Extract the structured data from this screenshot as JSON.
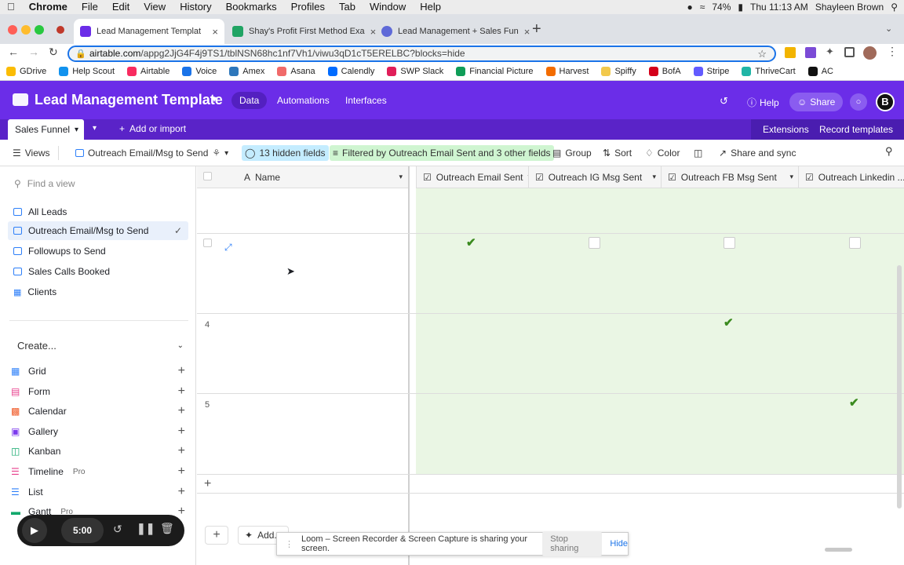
{
  "menubar": {
    "apple": "",
    "items": [
      "Chrome",
      "File",
      "Edit",
      "View",
      "History",
      "Bookmarks",
      "Profiles",
      "Tab",
      "Window",
      "Help"
    ],
    "battery": "74%",
    "clock": "Thu 11:13 AM",
    "user": "Shayleen Brown"
  },
  "tabs": [
    {
      "title": "Lead Management Templat",
      "favicon_color": "#6b2de8"
    },
    {
      "title": "Shay's Profit First Method Exa",
      "favicon_color": "#20a464"
    },
    {
      "title": "Lead Management + Sales Fun",
      "favicon_color": "#5f6ad8"
    }
  ],
  "url": {
    "host": "airtable.com",
    "path": "/appg2JjG4F4j9TS1/tblNSN68hc1nf7Vh1/viwu3qD1cT5ERELBC?blocks=hide"
  },
  "bookmarks": [
    {
      "label": "GDrive",
      "color": "#fbbc04"
    },
    {
      "label": "Help Scout",
      "color": "#1292ee"
    },
    {
      "label": "Airtable",
      "color": "#f82b60"
    },
    {
      "label": "Voice",
      "color": "#1a73e8"
    },
    {
      "label": "Amex",
      "color": "#2e77bb"
    },
    {
      "label": "Asana",
      "color": "#f06a6a"
    },
    {
      "label": "Calendly",
      "color": "#006bff"
    },
    {
      "label": "SWP Slack",
      "color": "#e01e5a"
    },
    {
      "label": "Financial Picture",
      "color": "#0f9d58"
    },
    {
      "label": "Harvest",
      "color": "#f36c00"
    },
    {
      "label": "Spiffy",
      "color": "#f2c94c"
    },
    {
      "label": "BofA",
      "color": "#d4001a"
    },
    {
      "label": "Stripe",
      "color": "#635bff"
    },
    {
      "label": "ThriveCart",
      "color": "#20b5a6"
    },
    {
      "label": "AC",
      "color": "#111111"
    }
  ],
  "airtable": {
    "base_name": "Lead Management Template",
    "nav": [
      "Data",
      "Automations",
      "Interfaces"
    ],
    "help": "Help",
    "share": "Share",
    "avatar": "B",
    "table_tab": "Sales Funnel",
    "add_import": "Add or import",
    "extensions": "Extensions",
    "record_templates": "Record templates"
  },
  "viewbar": {
    "views": "Views",
    "current_view": "Outreach Email/Msg to Send",
    "hidden_fields": "13 hidden fields",
    "filter": "Filtered by Outreach Email Sent and 3 other fields",
    "group": "Group",
    "sort": "Sort",
    "color": "Color",
    "share_sync": "Share and sync"
  },
  "sidebar": {
    "find_placeholder": "Find a view",
    "views": [
      "All Leads",
      "Outreach Email/Msg to Send",
      "Followups to Send",
      "Sales Calls Booked",
      "Clients"
    ],
    "create_label": "Create...",
    "create_items": [
      {
        "label": "Grid",
        "pro": ""
      },
      {
        "label": "Form",
        "pro": ""
      },
      {
        "label": "Calendar",
        "pro": ""
      },
      {
        "label": "Gallery",
        "pro": ""
      },
      {
        "label": "Kanban",
        "pro": ""
      },
      {
        "label": "Timeline",
        "pro": "Pro"
      },
      {
        "label": "List",
        "pro": ""
      },
      {
        "label": "Gantt",
        "pro": "Pro"
      }
    ]
  },
  "grid": {
    "name_header": "Name",
    "columns": [
      "Outreach Email Sent",
      "Outreach IG Msg Sent",
      "Outreach FB Msg Sent",
      "Outreach Linkedin ..."
    ],
    "rows": [
      {
        "num": "",
        "checks": [
          true,
          false,
          false,
          false
        ]
      },
      {
        "num": "4",
        "checks": [
          false,
          false,
          true,
          false
        ]
      },
      {
        "num": "5",
        "checks": [
          false,
          false,
          false,
          true
        ]
      }
    ],
    "add_label": "Add..."
  },
  "loom": {
    "timer": "5:00",
    "share_msg": "Loom – Screen Recorder & Screen Capture is sharing your screen.",
    "stop": "Stop sharing",
    "hide": "Hide"
  }
}
